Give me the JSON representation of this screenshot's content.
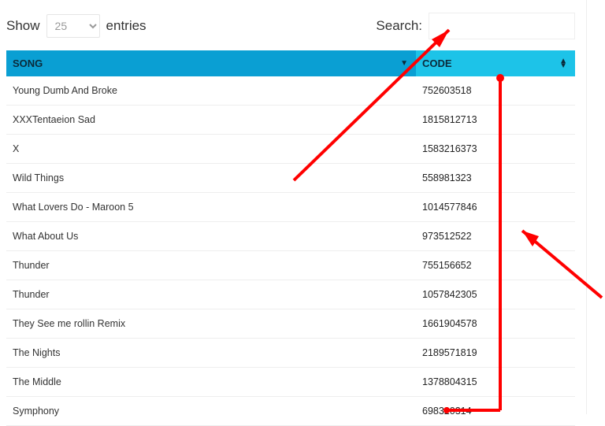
{
  "controls": {
    "show_label": "Show",
    "entries_label": "entries",
    "entries_value": "25",
    "search_label": "Search:",
    "search_value": ""
  },
  "columns": {
    "song": "SONG",
    "code": "CODE"
  },
  "rows": [
    {
      "song": "Young Dumb And Broke",
      "code": "752603518"
    },
    {
      "song": "XXXTentaeion Sad",
      "code": "1815812713"
    },
    {
      "song": "X",
      "code": "1583216373"
    },
    {
      "song": "Wild Things",
      "code": "558981323"
    },
    {
      "song": "What Lovers Do - Maroon 5",
      "code": "1014577846"
    },
    {
      "song": "What About Us",
      "code": "973512522"
    },
    {
      "song": "Thunder",
      "code": "755156652"
    },
    {
      "song": "Thunder",
      "code": "1057842305"
    },
    {
      "song": "They See me rollin Remix",
      "code": "1661904578"
    },
    {
      "song": "The Nights",
      "code": "2189571819"
    },
    {
      "song": "The Middle",
      "code": "1378804315"
    },
    {
      "song": "Symphony",
      "code": "698320314"
    }
  ]
}
